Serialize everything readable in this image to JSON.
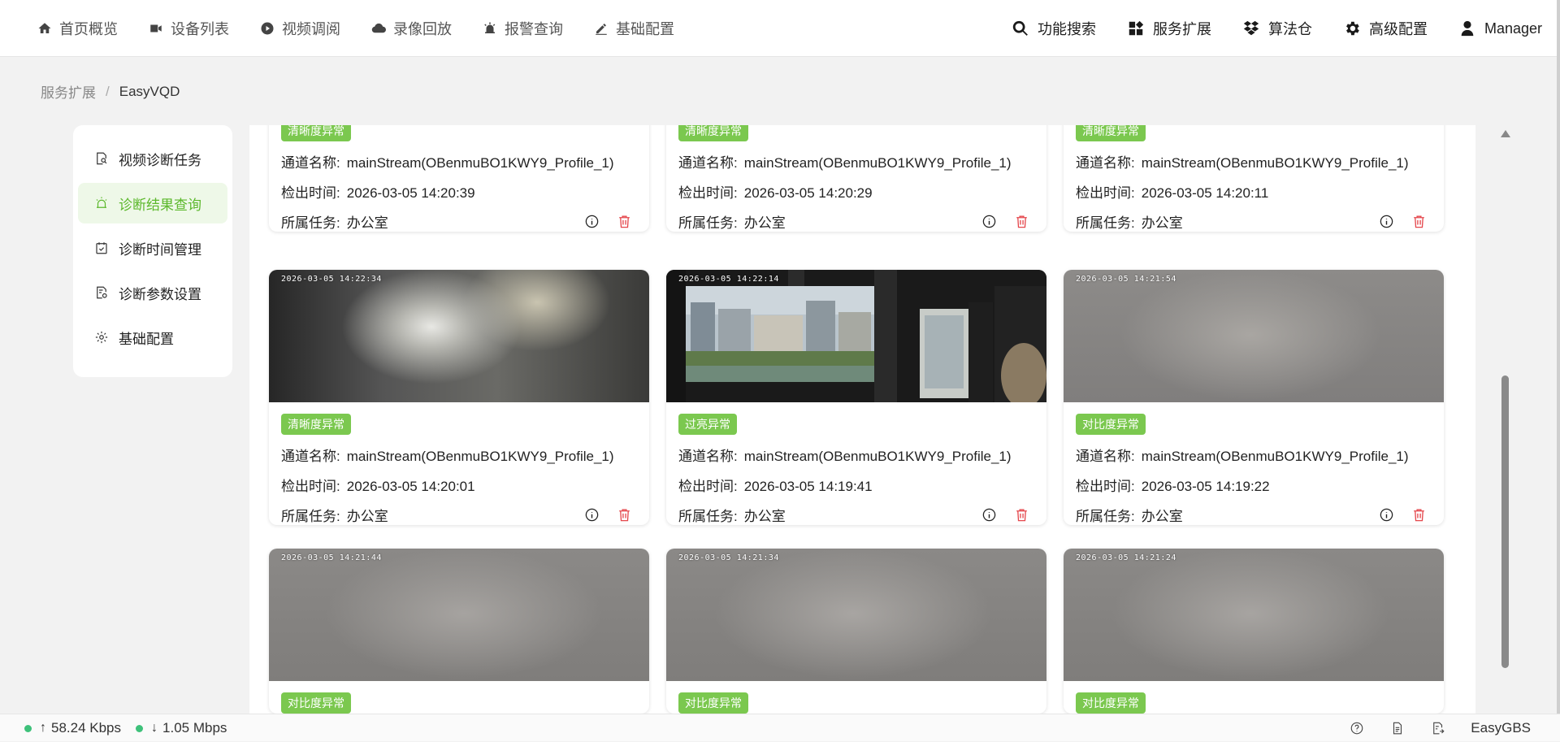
{
  "nav": {
    "left": [
      {
        "label": "首页概览",
        "icon": "home-icon"
      },
      {
        "label": "设备列表",
        "icon": "camera-icon"
      },
      {
        "label": "视频调阅",
        "icon": "play-icon"
      },
      {
        "label": "录像回放",
        "icon": "cloud-icon"
      },
      {
        "label": "报警查询",
        "icon": "alarm-icon"
      },
      {
        "label": "基础配置",
        "icon": "edit-icon"
      }
    ],
    "right": [
      {
        "label": "功能搜索",
        "icon": "search-icon"
      },
      {
        "label": "服务扩展",
        "icon": "apps-icon"
      },
      {
        "label": "算法仓",
        "icon": "dropbox-icon"
      },
      {
        "label": "高级配置",
        "icon": "gear-icon"
      },
      {
        "label": "Manager",
        "icon": "user-icon"
      }
    ]
  },
  "breadcrumb": {
    "parent": "服务扩展",
    "separator": "/",
    "current": "EasyVQD"
  },
  "sidebar": {
    "items": [
      {
        "label": "视频诊断任务",
        "icon": "task-search-icon",
        "active": false
      },
      {
        "label": "诊断结果查询",
        "icon": "alarm-lamp-icon",
        "active": true
      },
      {
        "label": "诊断时间管理",
        "icon": "calendar-check-icon",
        "active": false
      },
      {
        "label": "诊断参数设置",
        "icon": "doc-settings-icon",
        "active": false
      },
      {
        "label": "基础配置",
        "icon": "gear-icon",
        "active": false
      }
    ]
  },
  "card_labels": {
    "channel": "通道名称:",
    "time": "检出时间:",
    "task": "所属任务:"
  },
  "cards": [
    {
      "tag": "清晰度异常",
      "channel": "mainStream(OBenmuBO1KWY9_Profile_1)",
      "time": "2026-03-05 14:20:39",
      "task": "办公室",
      "thumb": ""
    },
    {
      "tag": "清晰度异常",
      "channel": "mainStream(OBenmuBO1KWY9_Profile_1)",
      "time": "2026-03-05 14:20:29",
      "task": "办公室",
      "thumb": ""
    },
    {
      "tag": "清晰度异常",
      "channel": "mainStream(OBenmuBO1KWY9_Profile_1)",
      "time": "2026-03-05 14:20:11",
      "task": "办公室",
      "thumb": ""
    },
    {
      "tag": "清晰度异常",
      "channel": "mainStream(OBenmuBO1KWY9_Profile_1)",
      "time": "2026-03-05 14:20:01",
      "task": "办公室",
      "thumb": "2026-03-05  14:22:34"
    },
    {
      "tag": "过亮异常",
      "channel": "mainStream(OBenmuBO1KWY9_Profile_1)",
      "time": "2026-03-05 14:19:41",
      "task": "办公室",
      "thumb": "2026-03-05  14:22:14"
    },
    {
      "tag": "对比度异常",
      "channel": "mainStream(OBenmuBO1KWY9_Profile_1)",
      "time": "2026-03-05 14:19:22",
      "task": "办公室",
      "thumb": "2026-03-05  14:21:54"
    },
    {
      "tag": "对比度异常",
      "channel": "",
      "time": "",
      "task": "",
      "thumb": "2026-03-05  14:21:44"
    },
    {
      "tag": "对比度异常",
      "channel": "",
      "time": "",
      "task": "",
      "thumb": "2026-03-05  14:21:34"
    },
    {
      "tag": "对比度异常",
      "channel": "",
      "time": "",
      "task": "",
      "thumb": "2026-03-05  14:21:24"
    }
  ],
  "status": {
    "upload": "58.24 Kbps",
    "download": "1.05 Mbps",
    "brand": "EasyGBS"
  },
  "colors": {
    "accent": "#5cb82c",
    "tag": "#7bc84f",
    "delete": "#e5484d",
    "online": "#3ec17a"
  }
}
